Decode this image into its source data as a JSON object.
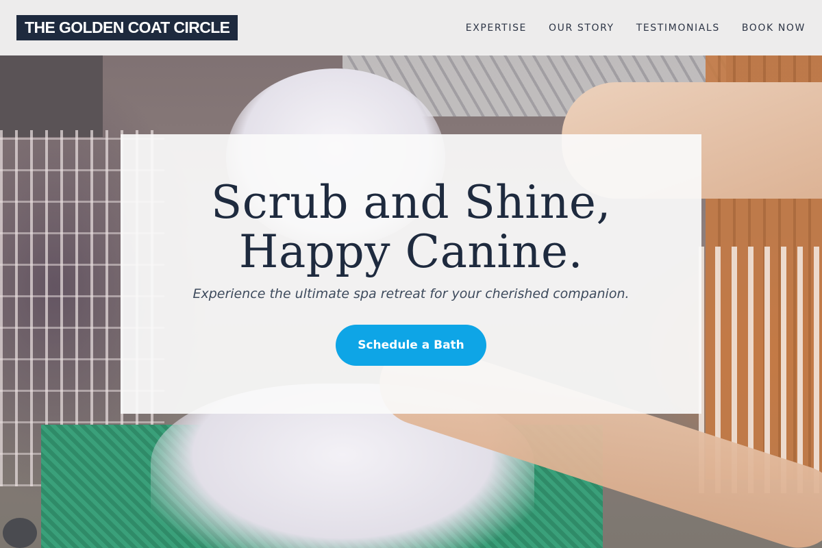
{
  "brand": {
    "logo_text": "THE GOLDEN COAT CIRCLE"
  },
  "nav": {
    "items": [
      {
        "label": "EXPERTISE"
      },
      {
        "label": "OUR STORY"
      },
      {
        "label": "TESTIMONIALS"
      },
      {
        "label": "BOOK NOW"
      }
    ]
  },
  "hero": {
    "title_line1": "Scrub and Shine,",
    "title_line2": "Happy Canine.",
    "subtitle": "Experience the ultimate spa retreat for your cherished companion.",
    "cta_label": "Schedule a Bath"
  },
  "colors": {
    "logo_background": "#1e2a3e",
    "cta_background": "#0ea5e6",
    "title_text": "#1e2a3e"
  }
}
